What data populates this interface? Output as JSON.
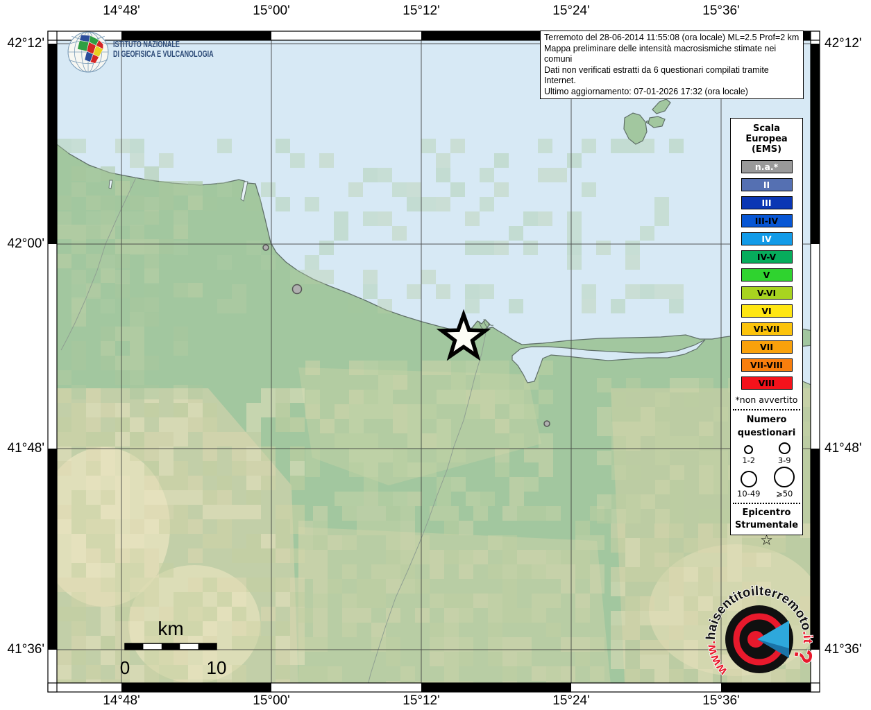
{
  "title": "Mappa macrosismica INGV",
  "axis": {
    "top_labels": [
      "14°48'",
      "15°00'",
      "15°12'",
      "15°24'",
      "15°36'"
    ],
    "bottom_labels": [
      "14°48'",
      "15°00'",
      "15°12'",
      "15°24'",
      "15°36'"
    ],
    "left_labels": [
      "42°12'",
      "42°00'",
      "41°48'",
      "41°36'"
    ],
    "right_labels": [
      "42°12'",
      "41°48'",
      "41°36'"
    ]
  },
  "info_box": {
    "lines": [
      "Terremoto del 28-06-2014 11:55:08 (ora locale) ML=2.5 Prof=2 km",
      "Mappa preliminare delle intensità macrosismiche stimate nei comuni",
      "Dati non verificati estratti da 6 questionari compilati tramite Internet.",
      "Ultimo aggiornamento: 07-01-2026 17:32 (ora locale)"
    ]
  },
  "ingv_logo": {
    "name_line1": "ISTITUTO NAZIONALE",
    "name_line2": "DI GEOFISICA E VULCANOLOGIA"
  },
  "legend": {
    "title_lines": [
      "Scala",
      "Europea",
      "(EMS)"
    ],
    "items": [
      {
        "label": "n.a.*",
        "color": "#999999",
        "text_color": "#ffffff"
      },
      {
        "label": "II",
        "color": "#5570b2",
        "text_color": "#ffffff"
      },
      {
        "label": "III",
        "color": "#0a36b4",
        "text_color": "#ffffff"
      },
      {
        "label": "III-IV",
        "color": "#0756d4",
        "text_color": "#000000"
      },
      {
        "label": "IV",
        "color": "#129be8",
        "text_color": "#ffffff"
      },
      {
        "label": "IV-V",
        "color": "#06ac5c",
        "text_color": "#000000"
      },
      {
        "label": "V",
        "color": "#2fd32f",
        "text_color": "#000000"
      },
      {
        "label": "V-VI",
        "color": "#a8d420",
        "text_color": "#000000"
      },
      {
        "label": "VI",
        "color": "#ffe612",
        "text_color": "#000000"
      },
      {
        "label": "VI-VII",
        "color": "#fcc30b",
        "text_color": "#000000"
      },
      {
        "label": "VII",
        "color": "#f9a10b",
        "text_color": "#000000"
      },
      {
        "label": "VII-VIII",
        "color": "#f87e0d",
        "text_color": "#000000"
      },
      {
        "label": "VIII",
        "color": "#f4121b",
        "text_color": "#000000"
      }
    ],
    "footnote": "*non avvertito",
    "questionnaires": {
      "title_lines": [
        "Numero",
        "questionari"
      ],
      "sizes": [
        "1-2",
        "3-9",
        "10-49",
        "⩾50"
      ]
    },
    "epicenter": {
      "title_lines": [
        "Epicentro",
        "Strumentale"
      ],
      "symbol": "☆"
    }
  },
  "scale_bar": {
    "unit": "km",
    "start_label": "0",
    "end_label": "10"
  },
  "watermark": {
    "prefix": "www.",
    "main": "haisentitoilterremoto",
    "suffix": ".it",
    "question_mark": "?"
  },
  "map_colors": {
    "sea": "#d7e9f5",
    "land": "#a2c79f",
    "coast_outline": "#5f6f68",
    "grid": "#3c3c3c"
  }
}
